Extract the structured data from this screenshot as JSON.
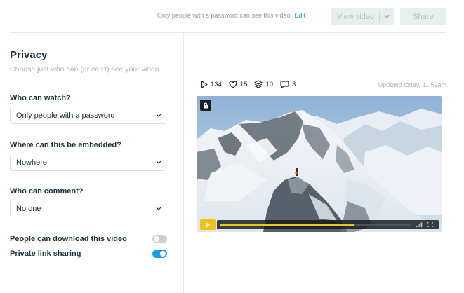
{
  "header": {
    "password_note": "Only people with a password can see this video",
    "edit_link": "Edit",
    "view_video_label": "View video",
    "share_label": "Share"
  },
  "privacy": {
    "title": "Privacy",
    "subtitle": "Choose just who can (or can't) see your video.",
    "who_can_watch": {
      "label": "Who can watch?",
      "value": "Only people with a password"
    },
    "embed": {
      "label": "Where can this be embedded?",
      "value": "Nowhere"
    },
    "comment": {
      "label": "Who can comment?",
      "value": "No one"
    },
    "download": {
      "label": "People can download this video",
      "enabled": false
    },
    "private_link": {
      "label": "Private link sharing",
      "enabled": true
    }
  },
  "stats": {
    "plays": "134",
    "likes": "15",
    "collections": "10",
    "comments": "3",
    "updated": "Updated today, 11:52am"
  },
  "player": {
    "progress": 0.7,
    "accent": "#f2c21a"
  },
  "colors": {
    "accent": "#1a9ee6",
    "text": "#1a2e3b",
    "muted": "#a8b4bc"
  }
}
